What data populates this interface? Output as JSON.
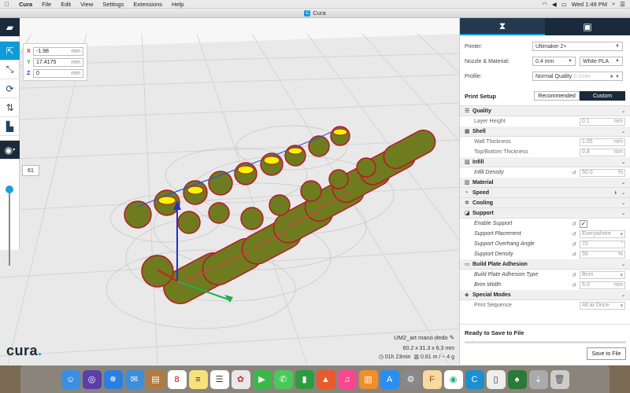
{
  "menubar": {
    "app": "Cura",
    "items": [
      "File",
      "Edit",
      "View",
      "Settings",
      "Extensions",
      "Help"
    ],
    "clock": "Wed 1:49 PM"
  },
  "window": {
    "title": "Cura"
  },
  "coords": {
    "x": "-1.98",
    "y": "17.4175",
    "z": "0",
    "unit": "mm",
    "x_label": "X",
    "y_label": "Y",
    "z_label": "Z"
  },
  "layer": {
    "value": "61",
    "fraction": 0.97
  },
  "logo": "cura",
  "model": {
    "name": "UM2_art mano dedo",
    "dims": "60.2 x 31.3 x 6.3 mm",
    "time": "01h 23min",
    "material": "0.61 m / ~ 4 g"
  },
  "panel": {
    "printer_label": "Printer:",
    "printer": "Ultimaker 2+",
    "nozzle_label": "Nozzle & Material:",
    "nozzle": "0.4 mm",
    "material": "White PLA",
    "profile_label": "Profile:",
    "profile": "Normal Quality",
    "profile_sub": "0.1mm",
    "setup_title": "Print Setup",
    "recommended": "Recommended",
    "custom": "Custom",
    "categories": [
      {
        "name": "Quality",
        "settings": [
          {
            "label": "Layer Height",
            "value": "0.1",
            "unit": "mm"
          }
        ]
      },
      {
        "name": "Shell",
        "settings": [
          {
            "label": "Wall Thickness",
            "value": "1.05",
            "unit": "mm"
          },
          {
            "label": "Top/Bottom Thickness",
            "value": "0.8",
            "unit": "mm"
          }
        ]
      },
      {
        "name": "Infill",
        "settings": [
          {
            "label": "Infill Density",
            "value": "50.0",
            "unit": "%"
          }
        ]
      },
      {
        "name": "Material"
      },
      {
        "name": "Speed"
      },
      {
        "name": "Cooling"
      },
      {
        "name": "Support",
        "settings": [
          {
            "label": "Enable Support"
          },
          {
            "label": "Support Placement",
            "value": "Everywhere"
          },
          {
            "label": "Support Overhang Angle",
            "value": "70",
            "unit": "°"
          },
          {
            "label": "Support Density",
            "value": "50",
            "unit": "%"
          }
        ]
      },
      {
        "name": "Build Plate Adhesion",
        "settings": [
          {
            "label": "Build Plate Adhesion Type",
            "value": "Brim"
          },
          {
            "label": "Brim Width",
            "value": "5.0",
            "unit": "mm"
          }
        ]
      },
      {
        "name": "Special Modes",
        "settings": [
          {
            "label": "Print Sequence",
            "value": "All at Once"
          }
        ]
      }
    ],
    "ready": "Ready to Save to File",
    "save": "Save to File"
  }
}
